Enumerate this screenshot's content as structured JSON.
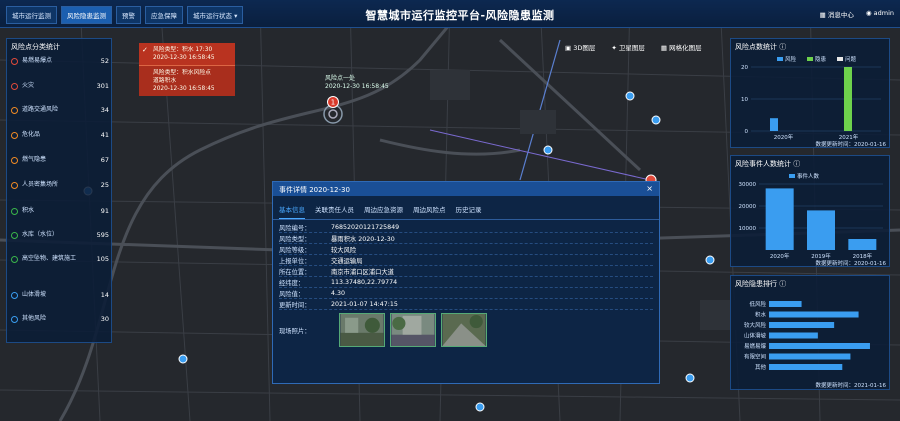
{
  "nav": {
    "items": [
      "城市运行监测",
      "风险隐患监测",
      "预警",
      "应急保障",
      "城市运行状态"
    ],
    "active_index": 1
  },
  "app_title": "智慧城市运行监控平台-风险隐患监测",
  "topbar_right": {
    "notifications": "消息中心",
    "user": "admin"
  },
  "left_panel": {
    "title": "风险点分类统计",
    "items": [
      {
        "label": "易燃易爆点",
        "count": "52",
        "color": "#e04a3b"
      },
      {
        "label": "火灾",
        "count": "301",
        "color": "#e04a3b"
      },
      {
        "label": "道路交通风险",
        "count": "34",
        "color": "#f08a24"
      },
      {
        "label": "危化品",
        "count": "41",
        "color": "#f08a24"
      },
      {
        "label": "燃气隐患",
        "count": "67",
        "color": "#f08a24"
      },
      {
        "label": "人员密集场所",
        "count": "25",
        "color": "#f08a24"
      },
      {
        "label": "积水",
        "count": "91",
        "color": "#3ab54a"
      },
      {
        "label": "水库（水位）",
        "count": "595",
        "color": "#3ab54a"
      },
      {
        "label": "高空坠物、建筑施工",
        "count": "105",
        "color": "#3ab54a"
      },
      {
        "label": "山体滑坡",
        "count": "14",
        "color": "#3a9df0"
      },
      {
        "label": "其他风险",
        "count": "30",
        "color": "#3a9df0"
      }
    ]
  },
  "alerts": [
    {
      "line1": "风险类型：积水 17:30",
      "line2": "2020-12-30 16:58:45"
    },
    {
      "line1": "风险类型：积水风险点",
      "line2": "道路积水",
      "line3": "2020-12-30 16:58:45"
    }
  ],
  "map_popup": {
    "line1": "风险点一处",
    "line2": "2020-12-30 16:58:45",
    "badge": "1"
  },
  "layer_buttons": [
    "3D图层",
    "卫星图层",
    "网格化图层"
  ],
  "modal": {
    "title": "事件详情 2020-12-30",
    "tabs": [
      "基本信息",
      "关联责任人员",
      "周边应急资源",
      "周边风险点",
      "历史记录"
    ],
    "rows": [
      {
        "k": "风险编号：",
        "v": "76852020121725849"
      },
      {
        "k": "风险类型：",
        "v": "暴雨积水 2020-12-30"
      },
      {
        "k": "风险等级：",
        "v": "较大风险"
      },
      {
        "k": "上报单位：",
        "v": "交通运输局"
      },
      {
        "k": "所在位置：",
        "v": "南京市浦口区浦口大道"
      },
      {
        "k": "经纬度：",
        "v": "113.37480,22.79774"
      },
      {
        "k": "风险值：",
        "v": "4.30"
      },
      {
        "k": "更新时间：",
        "v": "2021-01-07 14:47:15"
      }
    ],
    "photos_label": "现场照片："
  },
  "chart1": {
    "title": "风险点数统计",
    "legend": [
      "风险",
      "隐患",
      "问题"
    ],
    "footer": "数据更新时间：2020-01-16",
    "chart_data": {
      "type": "bar",
      "categories": [
        "2020年",
        "2021年"
      ],
      "series": [
        {
          "name": "风险",
          "values": [
            4,
            0
          ],
          "color": "#3a9df0"
        },
        {
          "name": "隐患",
          "values": [
            0,
            20
          ],
          "color": "#6ed24c"
        },
        {
          "name": "问题",
          "values": [
            0,
            0
          ],
          "color": "#e8e8e8"
        }
      ],
      "ylim": [
        0,
        20
      ],
      "yticks": [
        "20",
        "10",
        "0"
      ]
    }
  },
  "chart2": {
    "title": "风险事件人数统计",
    "legend": [
      "事件人数"
    ],
    "footer": "数据更新时间：2020-01-16",
    "chart_data": {
      "type": "bar",
      "categories": [
        "2020年",
        "2019年",
        "2018年"
      ],
      "values": [
        28000,
        18000,
        5000
      ],
      "ylim": [
        0,
        30000
      ],
      "yticks": [
        "30000",
        "20000",
        "10000"
      ]
    }
  },
  "chart3": {
    "title": "风险隐患排行",
    "footer": "数据更新时间：2021-01-16",
    "chart_data": {
      "type": "bar",
      "orientation": "horizontal",
      "categories": [
        "低风险",
        "积水",
        "较大风险",
        "山体滑坡",
        "易燃易爆",
        "有限空间",
        "其他"
      ],
      "values": [
        20,
        55,
        40,
        30,
        62,
        50,
        45
      ],
      "xlim": [
        0,
        70
      ]
    }
  }
}
